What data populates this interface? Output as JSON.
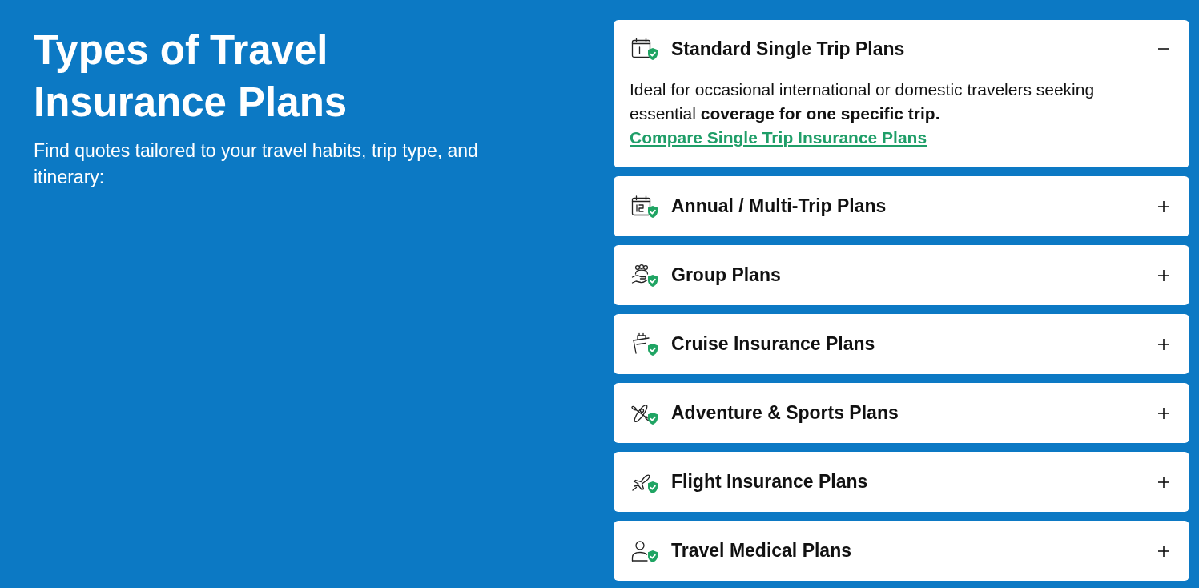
{
  "heading": "Types of Travel Insurance Plans",
  "subheading": "Find quotes tailored to your travel habits, trip type, and itinerary:",
  "plans": [
    {
      "title": "Standard Single Trip Plans",
      "expanded": true,
      "description": "Ideal for occasional international or domestic travelers seeking essential **coverage for one specific trip.**",
      "link": "Compare Single Trip Insurance Plans"
    },
    {
      "title": "Annual / Multi-Trip Plans",
      "expanded": false
    },
    {
      "title": "Group Plans",
      "expanded": false
    },
    {
      "title": "Cruise Insurance Plans",
      "expanded": false
    },
    {
      "title": "Adventure & Sports Plans",
      "expanded": false
    },
    {
      "title": "Flight Insurance Plans",
      "expanded": false
    },
    {
      "title": "Travel Medical Plans",
      "expanded": false
    }
  ]
}
